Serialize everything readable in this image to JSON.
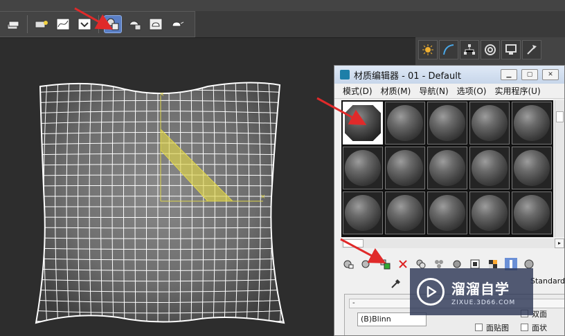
{
  "toolbar": {
    "icons": [
      "layer-stack-icon",
      "render-setup-icon",
      "curve-editor-icon",
      "schematic-icon",
      "material-editor-icon",
      "render-frame-icon",
      "render-teapot-icon",
      "render-teapot-active-icon"
    ],
    "active_icon": "material-editor-icon",
    "active_color": "#5a7ec4"
  },
  "command_panel": {
    "tabs": [
      "create-tab-icon",
      "modify-tab-icon",
      "hierarchy-tab-icon",
      "motion-tab-icon",
      "display-tab-icon",
      "utilities-tab-icon"
    ]
  },
  "material_editor": {
    "title": "材质编辑器 - 01 - Default",
    "window_buttons": [
      "minimize",
      "maximize",
      "close"
    ],
    "menu": [
      "模式(D)",
      "材质(M)",
      "导航(N)",
      "选项(O)",
      "实用程序(U)"
    ],
    "slot_rows": 3,
    "slot_cols": 5,
    "selected_slot": 0,
    "tools": [
      "get-material-icon",
      "put-to-scene-icon",
      "assign-to-selection-icon",
      "delete-icon",
      "make-copy-icon",
      "make-unique-icon",
      "put-to-library-icon",
      "material-id-icon",
      "show-background-icon",
      "show-in-viewport-icon",
      "options-icon"
    ],
    "material_type": "Standard",
    "rollout_label": "-",
    "shader": "(B)Blinn",
    "checkbox_labels": {
      "c1": "双面",
      "c2": "面贴图",
      "c3": "面状"
    }
  },
  "watermark": {
    "title": "溜溜自学",
    "url": "ZIXUE.3D66.COM"
  },
  "colors": {
    "annotation_arrow": "#e02a2a",
    "wire": "#ffffff",
    "gizmo": "#e0d64a",
    "viewport_bg": "#2d2d2d"
  }
}
